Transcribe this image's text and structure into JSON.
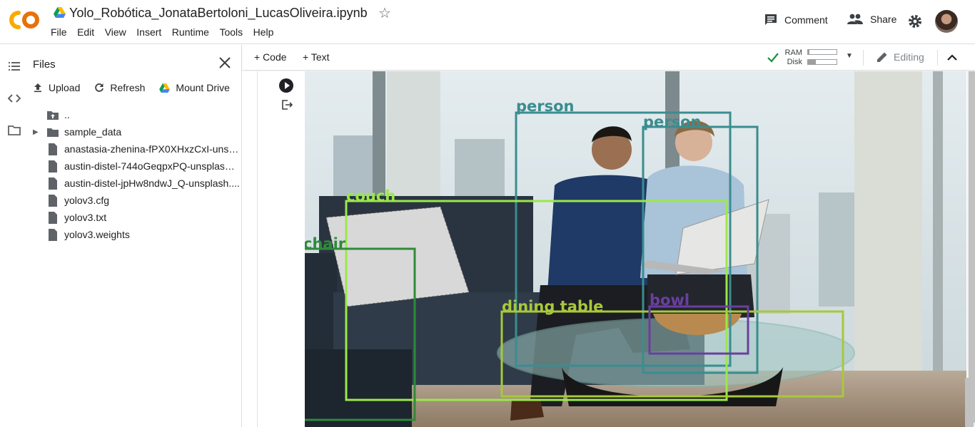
{
  "header": {
    "notebook_title": "Yolo_Robótica_JonataBertoloni_LucasOliveira.ipynb",
    "menu": [
      "File",
      "Edit",
      "View",
      "Insert",
      "Runtime",
      "Tools",
      "Help"
    ],
    "comment_label": "Comment",
    "share_label": "Share"
  },
  "sidebar": {
    "title": "Files",
    "actions": {
      "upload": "Upload",
      "refresh": "Refresh",
      "mount_drive": "Mount Drive"
    },
    "tree": [
      {
        "name": "..",
        "type": "parent"
      },
      {
        "name": "sample_data",
        "type": "folder"
      },
      {
        "name": "anastasia-zhenina-fPX0XHxzCxI-unsp...",
        "type": "file"
      },
      {
        "name": "austin-distel-744oGeqpxPQ-unsplash....",
        "type": "file"
      },
      {
        "name": "austin-distel-jpHw8ndwJ_Q-unsplash....",
        "type": "file"
      },
      {
        "name": "yolov3.cfg",
        "type": "file"
      },
      {
        "name": "yolov3.txt",
        "type": "file"
      },
      {
        "name": "yolov3.weights",
        "type": "file"
      }
    ]
  },
  "toolbar": {
    "add_code": "+ Code",
    "add_text": "+ Text",
    "ram_label": "RAM",
    "disk_label": "Disk",
    "ram_usage": 0.05,
    "disk_usage": 0.28,
    "editing_label": "Editing"
  },
  "detections": [
    {
      "label": "person",
      "color": "#3a8d8f"
    },
    {
      "label": "person",
      "color": "#3a8d8f"
    },
    {
      "label": "couch",
      "color": "#9be84a"
    },
    {
      "label": "chair",
      "color": "#2e8b3a"
    },
    {
      "label": "dining table",
      "color": "#a8c83c"
    },
    {
      "label": "bowl",
      "color": "#6a3fa0"
    }
  ],
  "colors": {
    "colab_orange": "#f9ab00",
    "check_green": "#1e8e3e"
  }
}
